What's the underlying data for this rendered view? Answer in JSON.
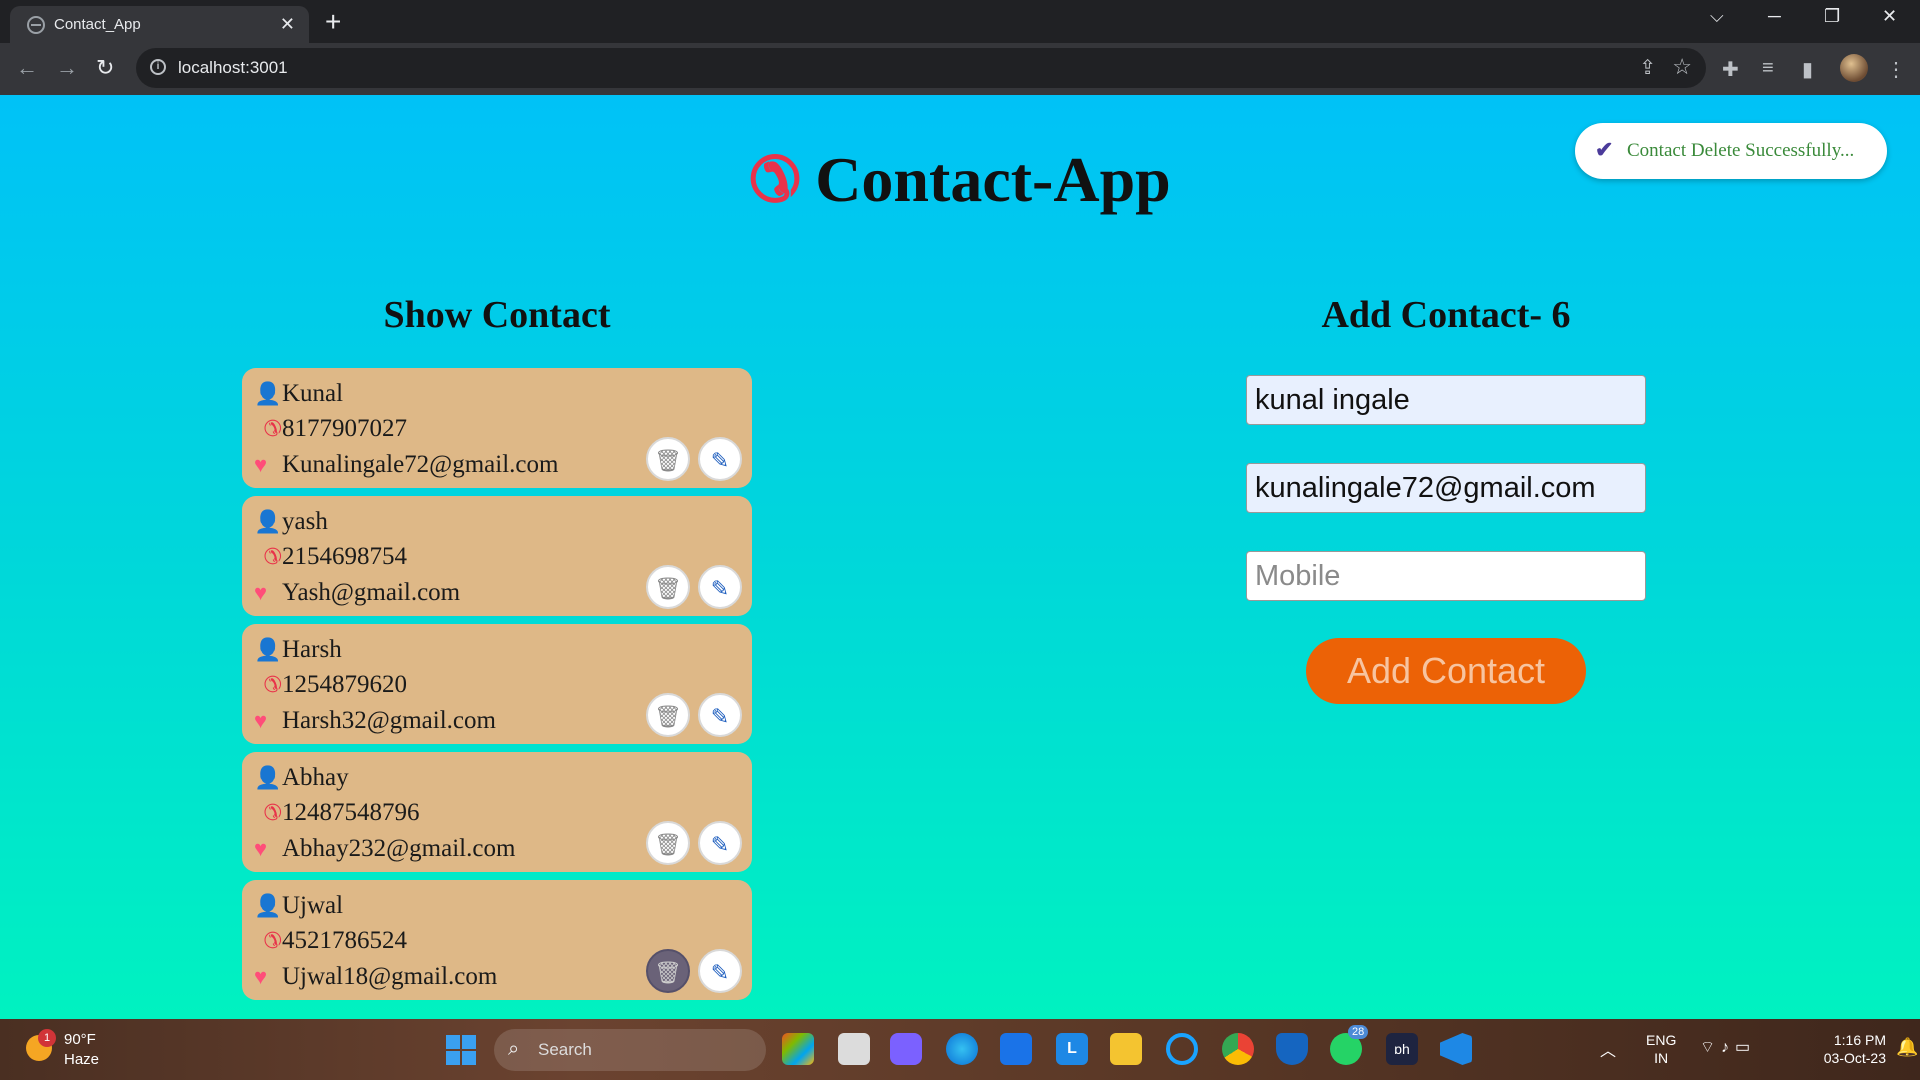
{
  "browser": {
    "tab_title": "Contact_App",
    "tab_close": "✕",
    "new_tab": "+",
    "url": "localhost:3001",
    "win_controls": {
      "dropdown": "⌵",
      "minimize": "─",
      "restore": "❐",
      "close": "✕"
    }
  },
  "app": {
    "title": "Contact-App",
    "toast": "Contact Delete Successfully...",
    "show_heading": "Show Contact",
    "add_heading": "Add Contact- 6",
    "contacts": [
      {
        "name": "Kunal",
        "phone": "8177907027",
        "email": "Kunalingale72@gmail.com"
      },
      {
        "name": "yash",
        "phone": "2154698754",
        "email": "Yash@gmail.com"
      },
      {
        "name": "Harsh",
        "phone": "1254879620",
        "email": "Harsh32@gmail.com"
      },
      {
        "name": "Abhay",
        "phone": "12487548796",
        "email": "Abhay232@gmail.com"
      },
      {
        "name": "Ujwal",
        "phone": "4521786524",
        "email": "Ujwal18@gmail.com"
      }
    ],
    "form": {
      "name_value": "kunal ingale",
      "email_value": "kunalingale72@gmail.com",
      "mobile_value": "",
      "mobile_placeholder": "Mobile",
      "submit_label": "Add Contact"
    }
  },
  "taskbar": {
    "weather_temp": "90°F",
    "weather_cond": "Haze",
    "weather_badge": "1",
    "search_placeholder": "Search",
    "whatsapp_badge": "28",
    "lang_top": "ENG",
    "lang_bottom": "IN",
    "time": "1:16 PM",
    "date": "03-Oct-23"
  },
  "colors": {
    "accent_button": "#ec6206",
    "card_bg": "#deb887",
    "page_gradient_top": "#00c2f7",
    "page_gradient_bottom": "#00f2c0"
  }
}
